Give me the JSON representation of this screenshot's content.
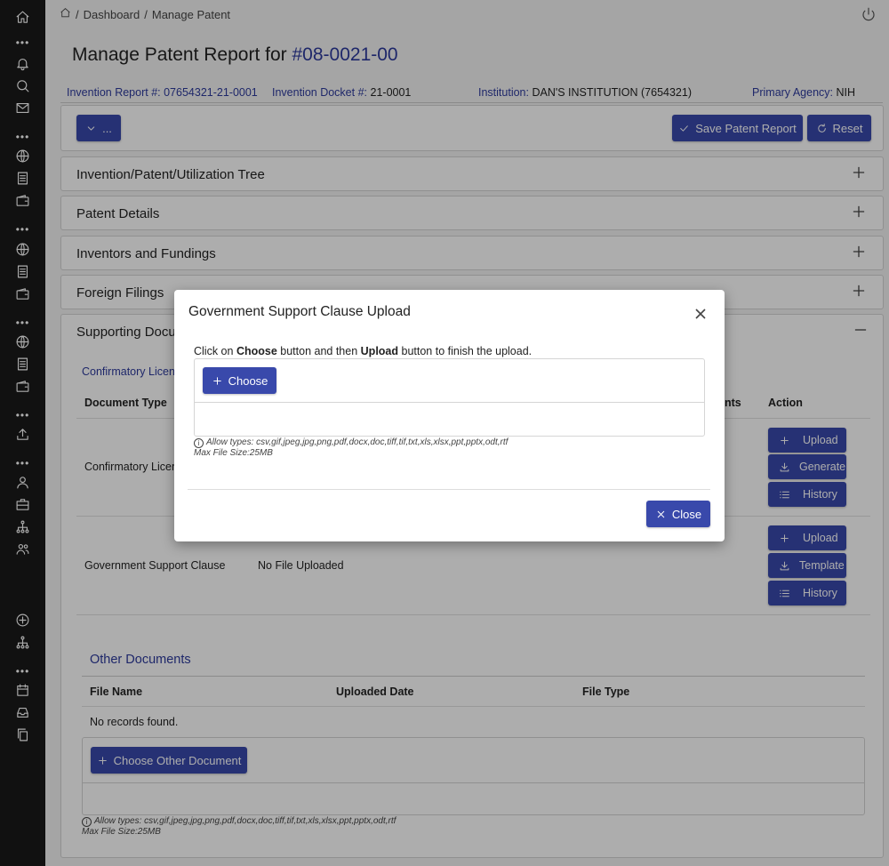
{
  "breadcrumb": {
    "sep": "/",
    "dashboard": "Dashboard",
    "current": "Manage Patent"
  },
  "page": {
    "title_prefix": "Manage Patent Report for",
    "report_number": "#08-0021-00"
  },
  "info": {
    "invention_report_label": "Invention Report #:",
    "invention_report_value": "07654321-21-0001",
    "docket_label": "Invention Docket #:",
    "docket_value": "21-0001",
    "institution_label": "Institution:",
    "institution_value": "DAN'S INSTITUTION (7654321)",
    "agency_label": "Primary Agency:",
    "agency_value": "NIH"
  },
  "toolbar": {
    "menu_label": "...",
    "save_label": "Save Patent Report",
    "reset_label": "Reset"
  },
  "panels": {
    "tree": "Invention/Patent/Utilization Tree",
    "details": "Patent Details",
    "inventors": "Inventors and Fundings",
    "foreign": "Foreign Filings",
    "supporting": "Supporting Docu"
  },
  "supporting": {
    "link": "Confirmatory Licen",
    "col_doc_type": "Document Type",
    "col_comments": "nts",
    "col_action": "Action",
    "rows": [
      {
        "type": "Confirmatory Licen",
        "status": "",
        "actions": [
          "Upload",
          "Generate",
          "History"
        ]
      },
      {
        "type": "Government Support Clause",
        "status": "No File Uploaded",
        "actions": [
          "Upload",
          "Template",
          "History"
        ]
      }
    ]
  },
  "other_docs": {
    "title": "Other Documents",
    "col_file_name": "File Name",
    "col_uploaded": "Uploaded Date",
    "col_file_type": "File Type",
    "empty": "No records found.",
    "choose_label": "Choose Other Document",
    "allow_types": "Allow types: csv,gif,jpeg,jpg,png,pdf,docx,doc,tiff,tif,txt,xls,xlsx,ppt,pptx,odt,rtf",
    "max_size": "Max File Size:25MB"
  },
  "modal": {
    "title": "Government Support Clause Upload",
    "instr_1": "Click on",
    "instr_choose": "Choose",
    "instr_2": "button and then",
    "instr_upload": "Upload",
    "instr_3": "button to finish the upload.",
    "choose_label": "Choose",
    "allow_types": "Allow types: csv,gif,jpeg,jpg,png,pdf,docx,doc,tiff,tif,txt,xls,xlsx,ppt,pptx,odt,rtf",
    "max_size": "Max File Size:25MB",
    "close_label": "Close"
  },
  "colors": {
    "primary": "#3949ab",
    "link": "#2d3a9c",
    "sidebar": "#1a1a1a"
  }
}
